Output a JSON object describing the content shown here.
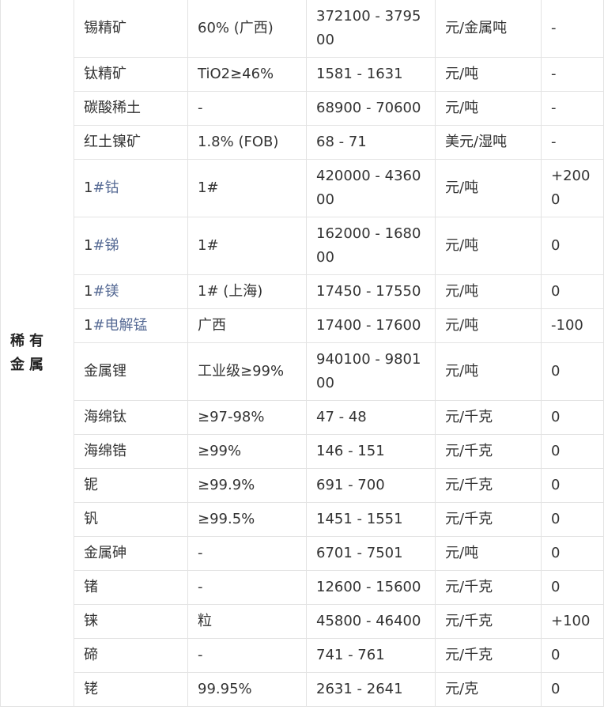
{
  "category": "稀有金属",
  "rows": [
    {
      "prefix": "",
      "name": "锡精矿",
      "linked": false,
      "spec": "60% (广西)",
      "price": "372100 - 379500",
      "unit": "元/金属吨",
      "change": "-"
    },
    {
      "prefix": "",
      "name": "钛精矿",
      "linked": false,
      "spec": "TiO2≥46%",
      "price": "1581 - 1631",
      "unit": "元/吨",
      "change": "-"
    },
    {
      "prefix": "",
      "name": "碳酸稀土",
      "linked": false,
      "spec": "-",
      "price": "68900 - 70600",
      "unit": "元/吨",
      "change": "-"
    },
    {
      "prefix": "",
      "name": "红土镍矿",
      "linked": false,
      "spec": "1.8% (FOB)",
      "price": "68 - 71",
      "unit": "美元/湿吨",
      "change": "-"
    },
    {
      "prefix": "1",
      "name": "#钴",
      "linked": true,
      "spec": "1#",
      "price": "420000 - 436000",
      "unit": "元/吨",
      "change": "+2000"
    },
    {
      "prefix": "1",
      "name": "#锑",
      "linked": true,
      "spec": "1#",
      "price": "162000 - 168000",
      "unit": "元/吨",
      "change": "0"
    },
    {
      "prefix": "1",
      "name": "#镁",
      "linked": true,
      "spec": "1# (上海)",
      "price": "17450 - 17550",
      "unit": "元/吨",
      "change": "0"
    },
    {
      "prefix": "1",
      "name": "#电解锰",
      "linked": true,
      "spec": "广西",
      "price": "17400 - 17600",
      "unit": "元/吨",
      "change": "-100"
    },
    {
      "prefix": "",
      "name": "金属锂",
      "linked": false,
      "spec": "工业级≥99%",
      "price": "940100 - 980100",
      "unit": "元/吨",
      "change": "0"
    },
    {
      "prefix": "",
      "name": "海绵钛",
      "linked": false,
      "spec": "≥97-98%",
      "price": "47 - 48",
      "unit": "元/千克",
      "change": "0"
    },
    {
      "prefix": "",
      "name": "海绵锆",
      "linked": false,
      "spec": "≥99%",
      "price": "146 - 151",
      "unit": "元/千克",
      "change": "0"
    },
    {
      "prefix": "",
      "name": "铌",
      "linked": false,
      "spec": "≥99.9%",
      "price": "691 - 700",
      "unit": "元/千克",
      "change": "0"
    },
    {
      "prefix": "",
      "name": "钒",
      "linked": false,
      "spec": "≥99.5%",
      "price": "1451 - 1551",
      "unit": "元/千克",
      "change": "0"
    },
    {
      "prefix": "",
      "name": "金属砷",
      "linked": false,
      "spec": "-",
      "price": "6701 - 7501",
      "unit": "元/吨",
      "change": "0"
    },
    {
      "prefix": "",
      "name": "锗",
      "linked": false,
      "spec": "-",
      "price": "12600 - 15600",
      "unit": "元/千克",
      "change": "0"
    },
    {
      "prefix": "",
      "name": "铼",
      "linked": false,
      "spec": "粒",
      "price": "45800 - 46400",
      "unit": "元/千克",
      "change": "+100"
    },
    {
      "prefix": "",
      "name": "碲",
      "linked": false,
      "spec": "-",
      "price": "741 - 761",
      "unit": "元/千克",
      "change": "0"
    },
    {
      "prefix": "",
      "name": "铑",
      "linked": false,
      "spec": "99.95%",
      "price": "2631 - 2641",
      "unit": "元/克",
      "change": "0"
    }
  ]
}
